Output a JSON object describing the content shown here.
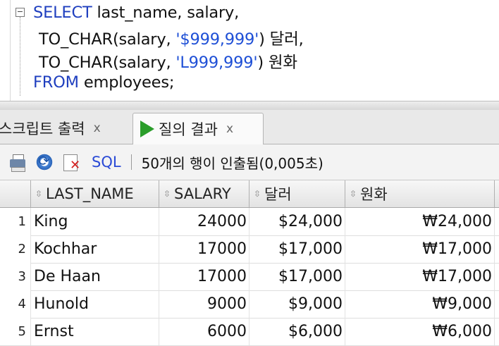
{
  "editor": {
    "fold_marker": "⊟",
    "line1": {
      "kw": "SELECT",
      "rest": " last_name, salary,"
    },
    "line2": {
      "pre": "TO_CHAR(salary, ",
      "str": "'$999,999'",
      "post": ") 달러,"
    },
    "line3": {
      "pre": "TO_CHAR(salary, ",
      "str": "'L999,999'",
      "post": ") 원화"
    },
    "line4": {
      "kw": "FROM",
      "rest": " employees;"
    }
  },
  "tabs": [
    {
      "label": "스크립트 출력",
      "close": "x"
    },
    {
      "label": "질의 결과",
      "close": "x",
      "icon": "run-icon"
    }
  ],
  "toolbar": {
    "sql_label": "SQL",
    "separator": "|",
    "status": "50개의 행이 인출됨(0,005초)"
  },
  "grid": {
    "columns": [
      "LAST_NAME",
      "SALARY",
      "달러",
      "원화"
    ],
    "rows": [
      {
        "n": "1",
        "last_name": "King",
        "salary": "24000",
        "dollar": "$24,000",
        "won": "₩24,000"
      },
      {
        "n": "2",
        "last_name": "Kochhar",
        "salary": "17000",
        "dollar": "$17,000",
        "won": "₩17,000"
      },
      {
        "n": "3",
        "last_name": "De Haan",
        "salary": "17000",
        "dollar": "$17,000",
        "won": "₩17,000"
      },
      {
        "n": "4",
        "last_name": "Hunold",
        "salary": "9000",
        "dollar": "$9,000",
        "won": "₩9,000"
      },
      {
        "n": "5",
        "last_name": "Ernst",
        "salary": "6000",
        "dollar": "$6,000",
        "won": "₩6,000"
      }
    ]
  },
  "colors": {
    "keyword": "#1f3fbf",
    "string": "#1e4fd6",
    "run_icon": "#2a9d2a",
    "sql_label": "#2a4ad6"
  }
}
